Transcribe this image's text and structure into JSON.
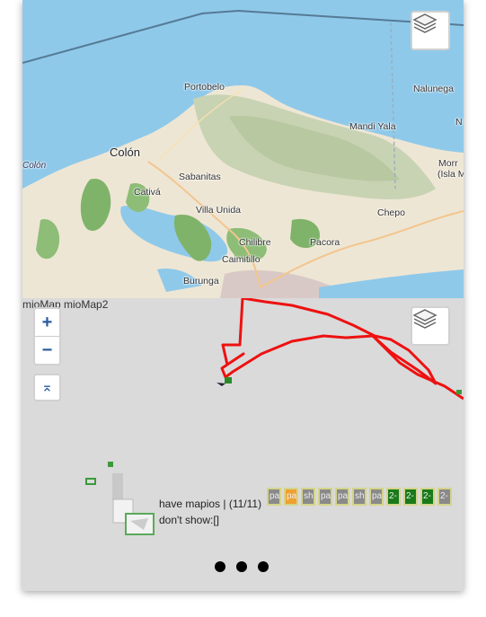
{
  "map_top": {
    "places": [
      {
        "name": "Portobelo",
        "cls": ""
      },
      {
        "name": "Nalunega",
        "cls": ""
      },
      {
        "name": "Mandi Yala",
        "cls": ""
      },
      {
        "name": "Colón",
        "cls": "big"
      },
      {
        "name": "Sabanitas",
        "cls": ""
      },
      {
        "name": "Colón",
        "cls": "it"
      },
      {
        "name": "Cativá",
        "cls": ""
      },
      {
        "name": "Villa Unida",
        "cls": ""
      },
      {
        "name": "Chepo",
        "cls": ""
      },
      {
        "name": "Chilibre",
        "cls": ""
      },
      {
        "name": "Pacora",
        "cls": ""
      },
      {
        "name": "Caimitillo",
        "cls": ""
      },
      {
        "name": "Burunga",
        "cls": ""
      },
      {
        "name": "Morr",
        "cls": ""
      },
      {
        "name": "(Isla M",
        "cls": ""
      },
      {
        "name": "N",
        "cls": ""
      }
    ],
    "layers_icon": "layers-icon"
  },
  "map_bottom": {
    "attribution": "mioMap mioMap2",
    "zoom_in": "+",
    "zoom_out": "−",
    "top_button": "⌅",
    "layers_icon": "layers-icon",
    "status_text": "have mapios | (11/11)",
    "dont_show_text": "don't show:[]",
    "chips": [
      {
        "label": "pa",
        "color": "#8a8a8a"
      },
      {
        "label": "pa",
        "color": "#f0a030"
      },
      {
        "label": "sh",
        "color": "#8a8a8a"
      },
      {
        "label": "pa",
        "color": "#8a8a8a"
      },
      {
        "label": "pa",
        "color": "#8a8a8a"
      },
      {
        "label": "sh",
        "color": "#8a8a8a"
      },
      {
        "label": "pa",
        "color": "#8a8a8a"
      },
      {
        "label": "2-",
        "color": "#1a7a1a"
      },
      {
        "label": "2-",
        "color": "#1a7a1a"
      },
      {
        "label": "2-",
        "color": "#1a7a1a"
      },
      {
        "label": "2-",
        "color": "#8a8a8a"
      }
    ],
    "track_color": "#ee1111"
  },
  "pager": {
    "dots": 3
  }
}
